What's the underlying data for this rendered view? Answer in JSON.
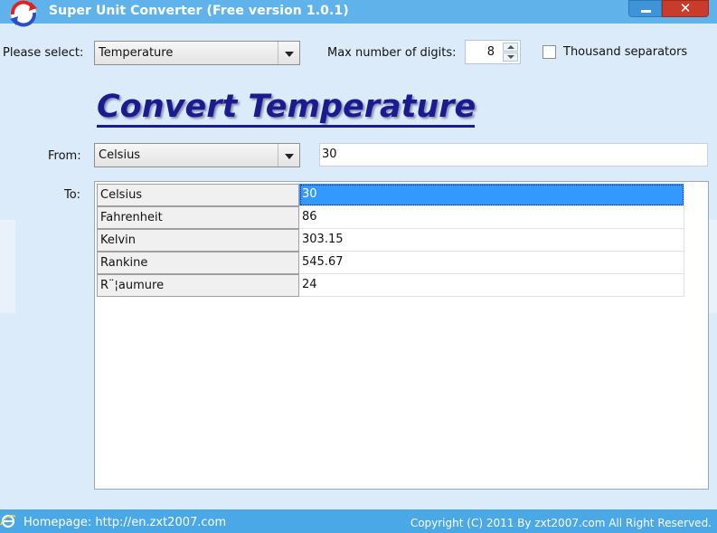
{
  "window": {
    "title": "Super Unit Converter (Free version 1.0.1)",
    "minimize_glyph": "—",
    "close_glyph": "✕"
  },
  "toolbar": {
    "select_label": "Please select:",
    "category_value": "Temperature",
    "max_digits_label": "Max number of digits:",
    "max_digits_value": "8",
    "thousand_sep_label": "Thousand separators",
    "thousand_sep_checked": false
  },
  "main": {
    "heading": "Convert  Temperature",
    "from_label": "From:",
    "from_unit": "Celsius",
    "from_value": "30",
    "to_label": "To:",
    "results": [
      {
        "unit": "Celsius",
        "value": "30",
        "selected": true
      },
      {
        "unit": "Fahrenheit",
        "value": "86",
        "selected": false
      },
      {
        "unit": "Kelvin",
        "value": "303.15",
        "selected": false
      },
      {
        "unit": "Rankine",
        "value": "545.67",
        "selected": false
      },
      {
        "unit": "R¨¦aumure",
        "value": "24",
        "selected": false
      }
    ]
  },
  "footer": {
    "homepage_text": "Homepage: http://en.zxt2007.com",
    "copyright_text": "Copyright (C) 2011 By zxt2007.com All Right Reserved."
  },
  "icons": {
    "app": "app-logo-icon",
    "homepage": "internet-explorer-icon"
  },
  "colors": {
    "title_bar": "#5fb3ea",
    "status_bar": "#4ba8e6",
    "heading": "#1b1a8f",
    "selection": "#3399ff",
    "close_button": "#c93b2b"
  }
}
